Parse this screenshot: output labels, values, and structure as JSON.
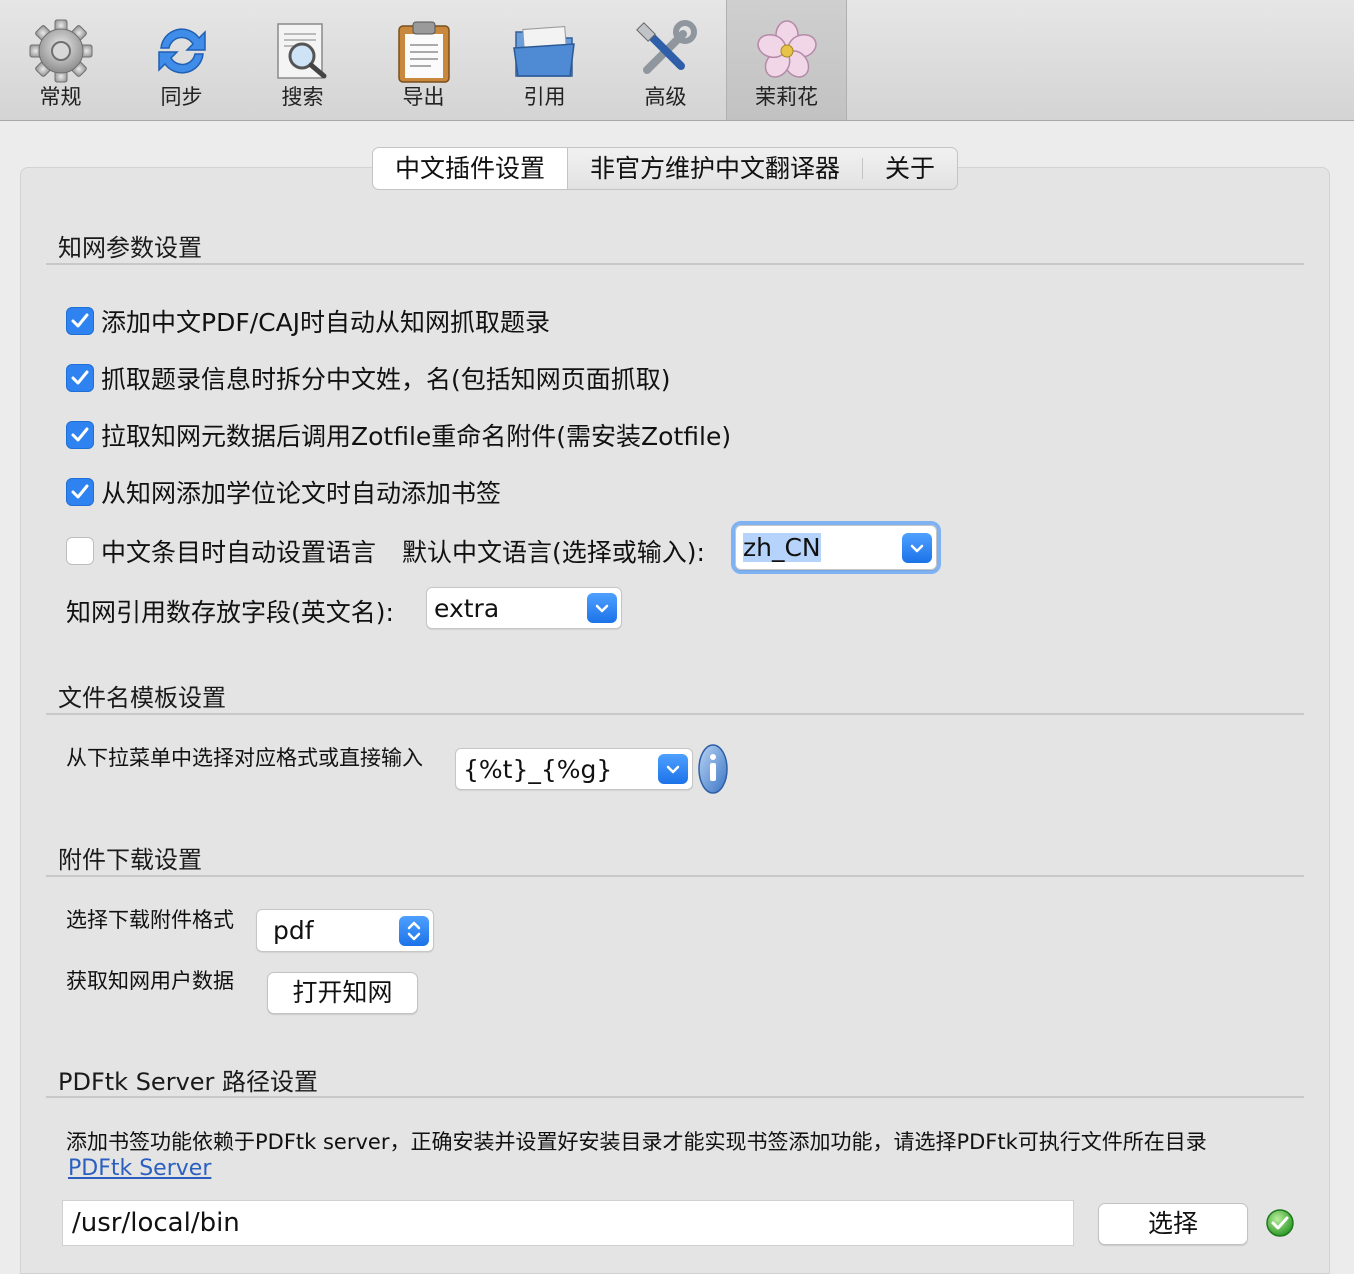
{
  "toolbar": {
    "items": [
      {
        "label": "常规",
        "icon": "gear-icon"
      },
      {
        "label": "同步",
        "icon": "sync-icon"
      },
      {
        "label": "搜索",
        "icon": "search-icon"
      },
      {
        "label": "导出",
        "icon": "clipboard-icon"
      },
      {
        "label": "引用",
        "icon": "folder-icon"
      },
      {
        "label": "高级",
        "icon": "tools-icon"
      },
      {
        "label": "茉莉花",
        "icon": "jasmine-flower-icon"
      }
    ],
    "selected": "茉莉花"
  },
  "tabs": [
    {
      "label": "中文插件设置",
      "active": true
    },
    {
      "label": "非官方维护中文翻译器",
      "active": false
    },
    {
      "label": "关于",
      "active": false
    }
  ],
  "cnki": {
    "title": "知网参数设置",
    "options": [
      {
        "label": "添加中文PDF/CAJ时自动从知网抓取题录",
        "checked": true
      },
      {
        "label": "抓取题录信息时拆分中文姓，名(包括知网页面抓取)",
        "checked": true
      },
      {
        "label": "拉取知网元数据后调用Zotfile重命名附件(需安装Zotfile)",
        "checked": true
      },
      {
        "label": "从知网添加学位论文时自动添加书签",
        "checked": true
      }
    ],
    "language": {
      "checkbox_label": "中文条目时自动设置语言",
      "checked": false,
      "default_label": "默认中文语言(选择或输入):",
      "value": "zh_CN"
    },
    "citation_field": {
      "label": "知网引用数存放字段(英文名):",
      "value": "extra"
    }
  },
  "filename": {
    "title": "文件名模板设置",
    "label": "从下拉菜单中选择对应格式或直接输入",
    "value": "{%t}_{%g}"
  },
  "attachment": {
    "title": "附件下载设置",
    "format_label": "选择下载附件格式",
    "format_value": "pdf",
    "user_data_label": "获取知网用户数据",
    "open_button": "打开知网"
  },
  "pdftk": {
    "title": "PDFtk Server 路径设置",
    "description": "添加书签功能依赖于PDFtk server，正确安装并设置好安装目录才能实现书签添加功能，请选择PDFtk可执行文件所在目录",
    "link": "PDFtk Server",
    "path": "/usr/local/bin",
    "choose_button": "选择"
  },
  "colors": {
    "accent": "#2f83f0",
    "link": "#2a5fc0",
    "ok": "#3cb043"
  }
}
